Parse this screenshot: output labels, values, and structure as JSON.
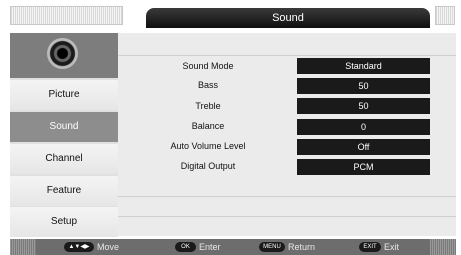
{
  "header": {
    "title": "Sound"
  },
  "sidebar": {
    "items": [
      {
        "label": "Picture"
      },
      {
        "label": "Sound"
      },
      {
        "label": "Channel"
      },
      {
        "label": "Feature"
      },
      {
        "label": "Setup"
      }
    ],
    "active": "Sound",
    "icon": "speaker-icon"
  },
  "settings": [
    {
      "label": "Sound Mode",
      "value": "Standard"
    },
    {
      "label": "Bass",
      "value": "50"
    },
    {
      "label": "Treble",
      "value": "50"
    },
    {
      "label": "Balance",
      "value": "0"
    },
    {
      "label": "Auto Volume Level",
      "value": "Off"
    },
    {
      "label": "Digital Output",
      "value": "PCM"
    }
  ],
  "footer": {
    "move_key": "▲▼◀▶",
    "move_label": "Move",
    "ok_key": "OK",
    "ok_label": "Enter",
    "menu_key": "MENU",
    "menu_label": "Return",
    "exit_key": "EXIT",
    "exit_label": "Exit"
  },
  "colors": {
    "header_bg": "#1a1a1a",
    "value_bg": "#1a1a1a",
    "active_item_bg": "#8d8d8d",
    "footer_bg": "#6d6d6d"
  }
}
